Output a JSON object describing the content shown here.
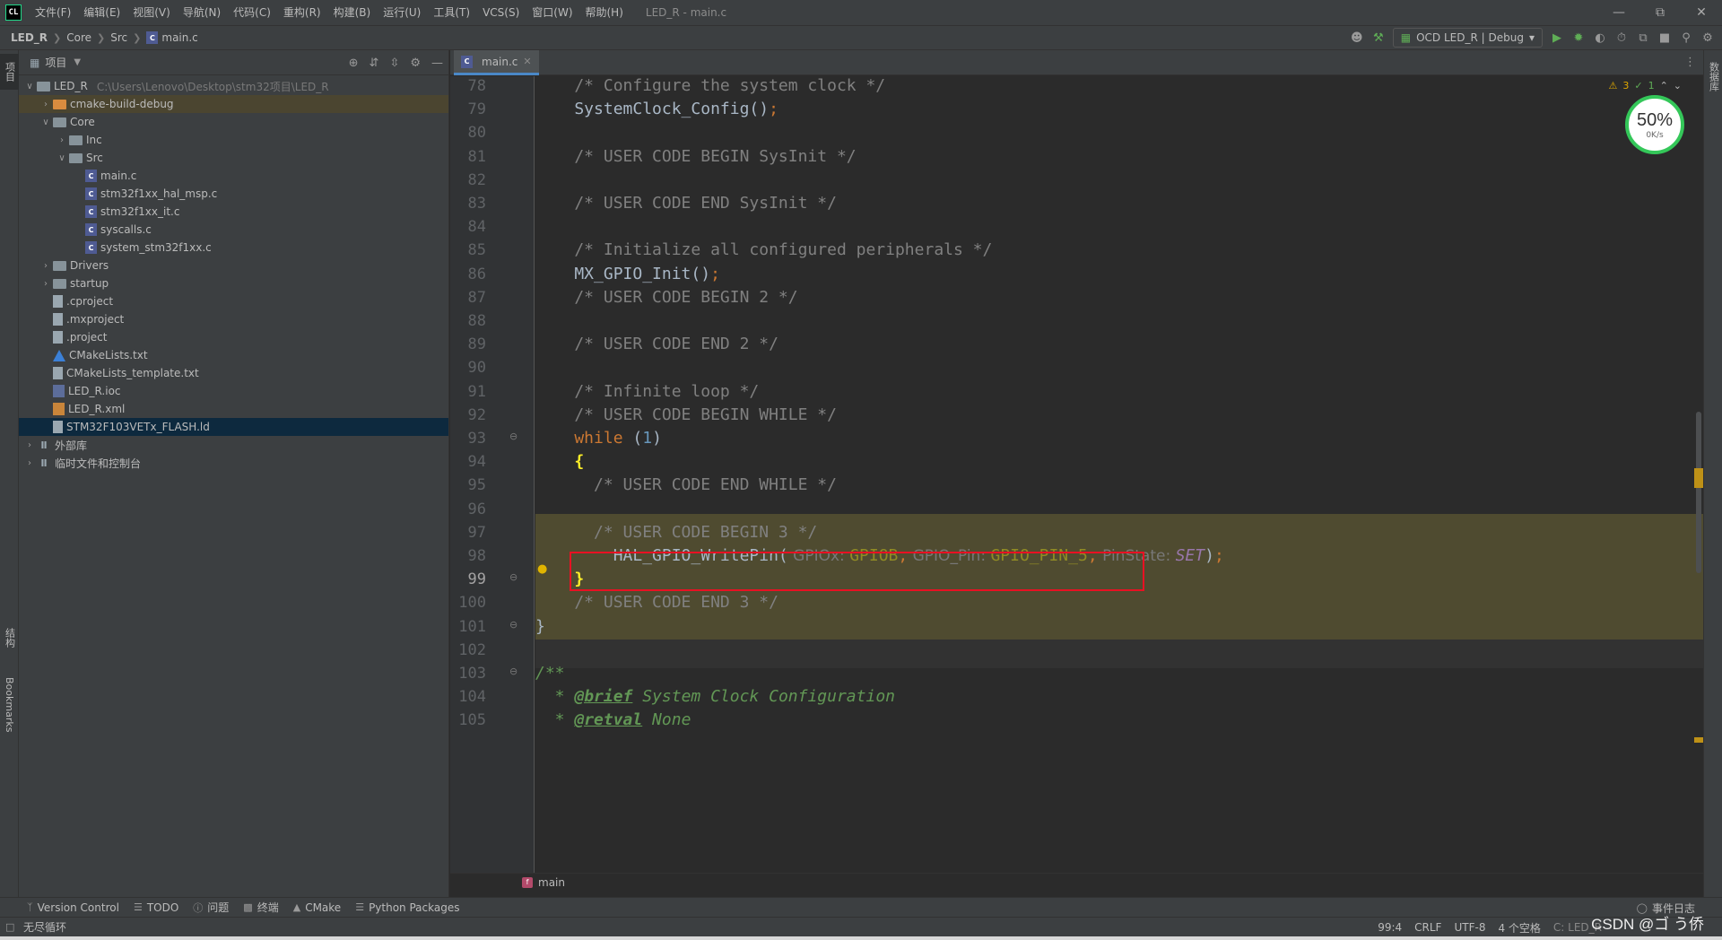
{
  "app": {
    "logo": "CL",
    "window_title": "LED_R - main.c",
    "menu": [
      "文件(F)",
      "编辑(E)",
      "视图(V)",
      "导航(N)",
      "代码(C)",
      "重构(R)",
      "构建(B)",
      "运行(U)",
      "工具(T)",
      "VCS(S)",
      "窗口(W)",
      "帮助(H)"
    ]
  },
  "breadcrumb": {
    "root": "LED_R",
    "items": [
      "Core",
      "Src",
      "main.c"
    ]
  },
  "run_config": {
    "label": "OCD LED_R | Debug"
  },
  "project": {
    "title": "项目",
    "tree": [
      {
        "label": "LED_R",
        "path": "C:\\Users\\Lenovo\\Desktop\\stm32项目\\LED_R",
        "level": 0,
        "arrow": "open",
        "icon": "folder"
      },
      {
        "label": "cmake-build-debug",
        "level": 1,
        "arrow": "closed",
        "icon": "folder-orange",
        "highlight": true
      },
      {
        "label": "Core",
        "level": 1,
        "arrow": "open",
        "icon": "folder"
      },
      {
        "label": "Inc",
        "level": 2,
        "arrow": "closed",
        "icon": "folder"
      },
      {
        "label": "Src",
        "level": 2,
        "arrow": "open",
        "icon": "folder"
      },
      {
        "label": "main.c",
        "level": 3,
        "arrow": "",
        "icon": "cfile"
      },
      {
        "label": "stm32f1xx_hal_msp.c",
        "level": 3,
        "arrow": "",
        "icon": "cfile"
      },
      {
        "label": "stm32f1xx_it.c",
        "level": 3,
        "arrow": "",
        "icon": "cfile"
      },
      {
        "label": "syscalls.c",
        "level": 3,
        "arrow": "",
        "icon": "cfile"
      },
      {
        "label": "system_stm32f1xx.c",
        "level": 3,
        "arrow": "",
        "icon": "cfile"
      },
      {
        "label": "Drivers",
        "level": 1,
        "arrow": "closed",
        "icon": "folder"
      },
      {
        "label": "startup",
        "level": 1,
        "arrow": "closed",
        "icon": "folder"
      },
      {
        "label": ".cproject",
        "level": 1,
        "arrow": "",
        "icon": "doc"
      },
      {
        "label": ".mxproject",
        "level": 1,
        "arrow": "",
        "icon": "doc"
      },
      {
        "label": ".project",
        "level": 1,
        "arrow": "",
        "icon": "doc"
      },
      {
        "label": "CMakeLists.txt",
        "level": 1,
        "arrow": "",
        "icon": "cmake"
      },
      {
        "label": "CMakeLists_template.txt",
        "level": 1,
        "arrow": "",
        "icon": "doc"
      },
      {
        "label": "LED_R.ioc",
        "level": 1,
        "arrow": "",
        "icon": "ioc"
      },
      {
        "label": "LED_R.xml",
        "level": 1,
        "arrow": "",
        "icon": "xml"
      },
      {
        "label": "STM32F103VETx_FLASH.ld",
        "level": 1,
        "arrow": "",
        "icon": "doc",
        "selected": true
      },
      {
        "label": "外部库",
        "level": 0,
        "arrow": "closed",
        "icon": "lib"
      },
      {
        "label": "临时文件和控制台",
        "level": 0,
        "arrow": "closed",
        "icon": "lib"
      }
    ]
  },
  "editor": {
    "tab": "main.c",
    "inspections": {
      "warnings": "3",
      "ok": "1"
    },
    "current_line": 99,
    "lines": [
      {
        "n": "78",
        "tokens": [
          [
            "cmt",
            "    /* Configure the system clock */"
          ]
        ]
      },
      {
        "n": "79",
        "tokens": [
          [
            "fn",
            "    SystemClock_Config()"
          ],
          [
            "punc",
            ";"
          ]
        ]
      },
      {
        "n": "80",
        "tokens": []
      },
      {
        "n": "81",
        "tokens": [
          [
            "cmt",
            "    /* USER CODE BEGIN SysInit */"
          ]
        ]
      },
      {
        "n": "82",
        "tokens": []
      },
      {
        "n": "83",
        "tokens": [
          [
            "cmt",
            "    /* USER CODE END SysInit */"
          ]
        ]
      },
      {
        "n": "84",
        "tokens": []
      },
      {
        "n": "85",
        "tokens": [
          [
            "cmt",
            "    /* Initialize all configured peripherals */"
          ]
        ]
      },
      {
        "n": "86",
        "tokens": [
          [
            "fn",
            "    MX_GPIO_Init()"
          ],
          [
            "punc",
            ";"
          ]
        ]
      },
      {
        "n": "87",
        "tokens": [
          [
            "cmt",
            "    /* USER CODE BEGIN 2 */"
          ]
        ]
      },
      {
        "n": "88",
        "tokens": []
      },
      {
        "n": "89",
        "tokens": [
          [
            "cmt",
            "    /* USER CODE END 2 */"
          ]
        ]
      },
      {
        "n": "90",
        "tokens": []
      },
      {
        "n": "91",
        "tokens": [
          [
            "cmt",
            "    /* Infinite loop */"
          ]
        ]
      },
      {
        "n": "92",
        "tokens": [
          [
            "cmt",
            "    /* USER CODE BEGIN WHILE */"
          ]
        ]
      },
      {
        "n": "93",
        "tokens": [
          [
            "kw",
            "    while "
          ],
          [
            "plain",
            "("
          ],
          [
            "num",
            "1"
          ],
          [
            "plain",
            ")"
          ]
        ]
      },
      {
        "n": "94",
        "tokens": [
          [
            "brace-hl",
            "    {"
          ]
        ]
      },
      {
        "n": "95",
        "tokens": [
          [
            "cmt",
            "      /* USER CODE END WHILE */"
          ]
        ]
      },
      {
        "n": "96",
        "tokens": []
      },
      {
        "n": "97",
        "tokens": [
          [
            "cmt",
            "      /* USER CODE BEGIN 3 */"
          ]
        ]
      },
      {
        "n": "98",
        "tokens": [
          [
            "fn",
            "        HAL_GPIO_WritePin("
          ],
          [
            "param-hint",
            " GPIOx: "
          ],
          [
            "macro",
            "GPIOB"
          ],
          [
            "punc",
            ","
          ],
          [
            "param-hint",
            " GPIO_Pin: "
          ],
          [
            "macro",
            "GPIO_PIN_5"
          ],
          [
            "punc",
            ","
          ],
          [
            "param-hint",
            " PinState: "
          ],
          [
            "enumv",
            "SET"
          ],
          [
            "plain",
            ")"
          ],
          [
            "punc",
            ";"
          ]
        ]
      },
      {
        "n": "99",
        "tokens": [
          [
            "brace-hl",
            "    }"
          ]
        ]
      },
      {
        "n": "100",
        "tokens": [
          [
            "cmt",
            "    /* USER CODE END 3 */"
          ]
        ]
      },
      {
        "n": "101",
        "tokens": [
          [
            "plain",
            "}"
          ]
        ]
      },
      {
        "n": "102",
        "tokens": []
      },
      {
        "n": "103",
        "tokens": [
          [
            "doc",
            "/**"
          ]
        ]
      },
      {
        "n": "104",
        "tokens": [
          [
            "doc",
            "  * "
          ],
          [
            "doc-tag",
            "@brief"
          ],
          [
            "doc",
            " System Clock Configuration"
          ]
        ]
      },
      {
        "n": "105",
        "tokens": [
          [
            "doc",
            "  * "
          ],
          [
            "doc-tag",
            "@retval"
          ],
          [
            "doc",
            " None"
          ]
        ]
      }
    ],
    "footer_function": "main"
  },
  "perf": {
    "percent": "50%",
    "rate": "0K/s"
  },
  "tool_windows": [
    "Version Control",
    "TODO",
    "问题",
    "终端",
    "CMake",
    "Python Packages"
  ],
  "event_log": "事件日志",
  "status": {
    "message": "无尽循环",
    "position": "99:4",
    "line_ending": "CRLF",
    "encoding": "UTF-8",
    "indent": "4 个空格",
    "context": "C: LED_R"
  },
  "stripe": {
    "project": "项目",
    "structure": "结构",
    "bookmarks": "Bookmarks",
    "right": "数据库"
  },
  "watermark": "CSDN @ゴ う侨"
}
